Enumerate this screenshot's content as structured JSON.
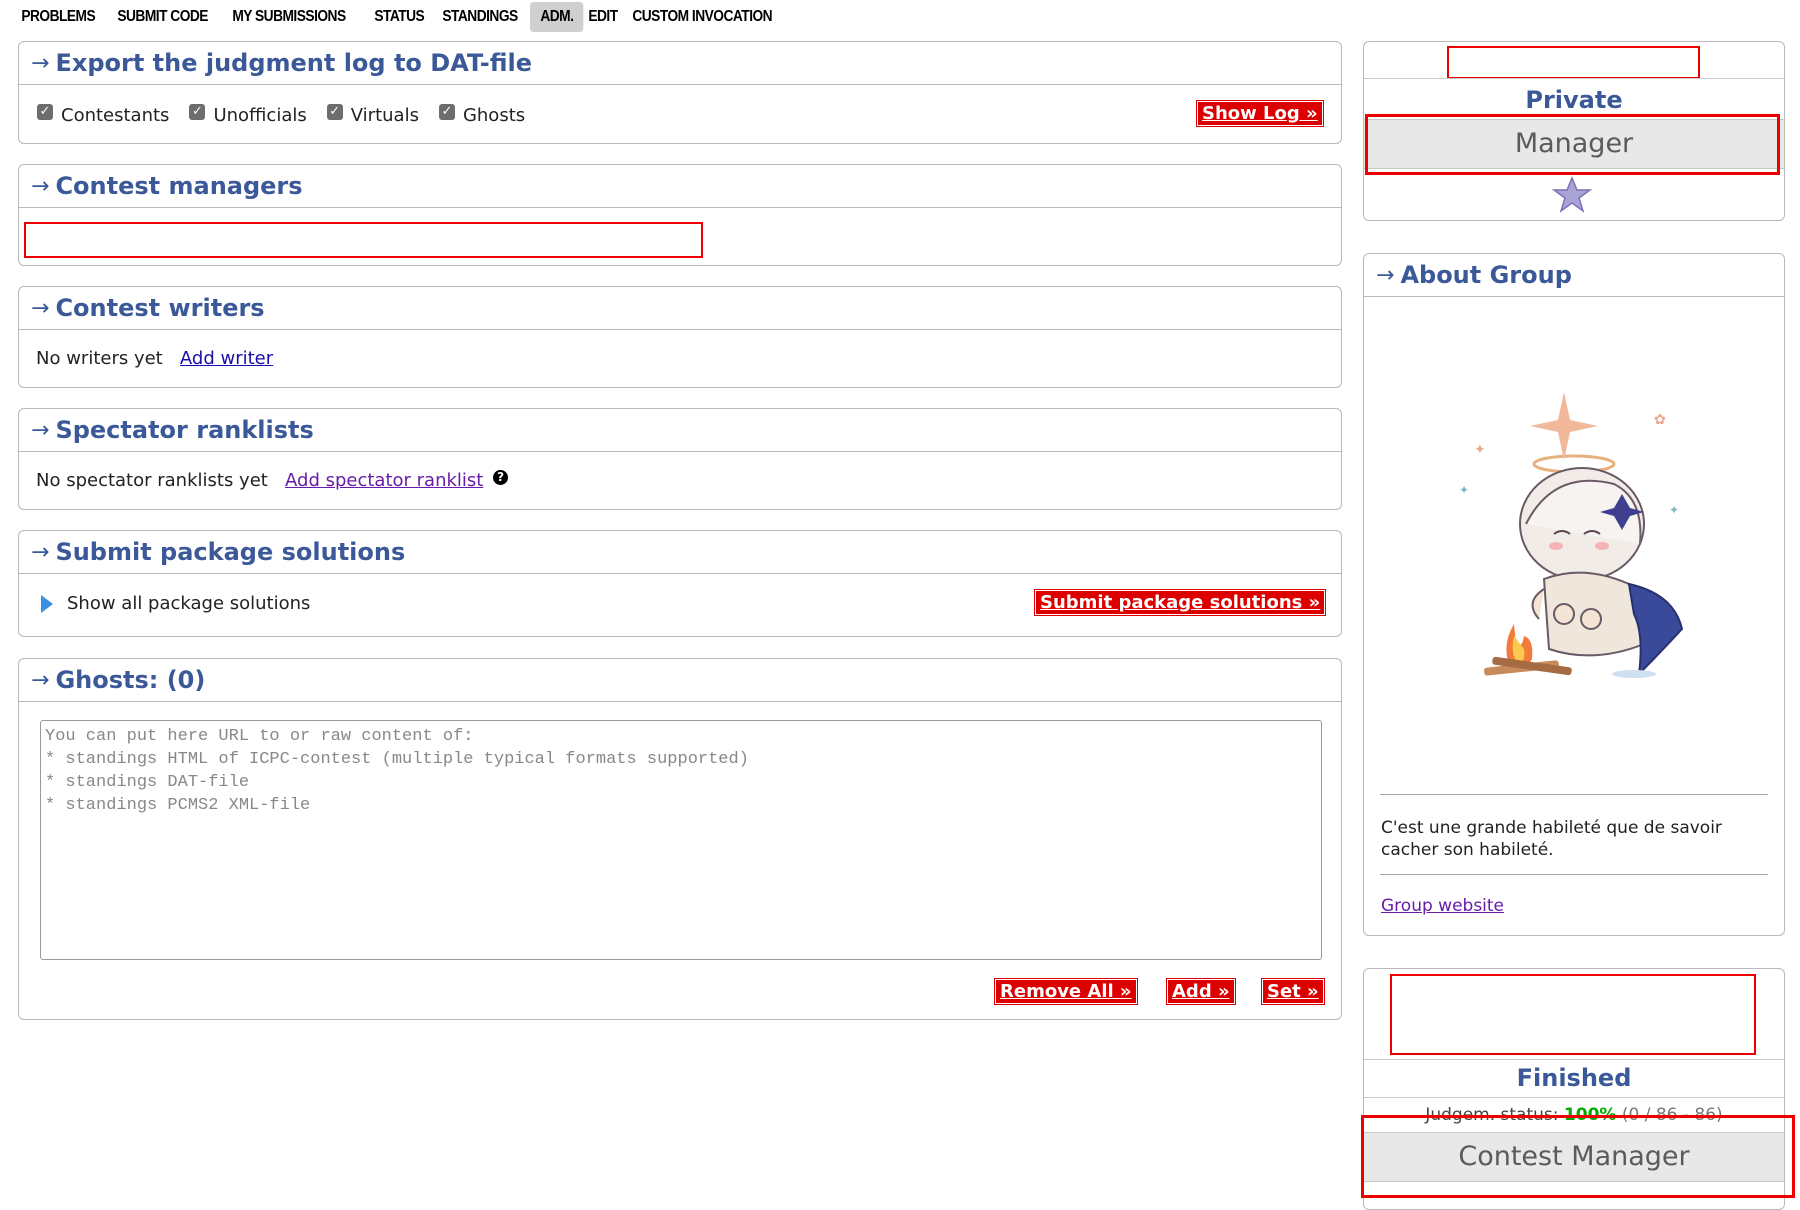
{
  "menu": [
    {
      "label": "PROBLEMS",
      "active": false
    },
    {
      "label": "SUBMIT CODE",
      "active": false
    },
    {
      "label": "MY SUBMISSIONS",
      "active": false
    },
    {
      "label": "STATUS",
      "active": false
    },
    {
      "label": "STANDINGS",
      "active": false
    },
    {
      "label": "ADM.",
      "active": true
    },
    {
      "label": "EDIT",
      "active": false
    },
    {
      "label": "CUSTOM INVOCATION",
      "active": false
    }
  ],
  "export": {
    "arrow": "→",
    "title": "Export the judgment log to DAT-file",
    "checkboxes": [
      {
        "label": "Contestants",
        "checked": true
      },
      {
        "label": "Unofficials",
        "checked": true
      },
      {
        "label": "Virtuals",
        "checked": true
      },
      {
        "label": "Ghosts",
        "checked": true
      }
    ],
    "show_log": "Show Log »"
  },
  "managers": {
    "arrow": "→",
    "title": "Contest managers"
  },
  "writers": {
    "arrow": "→",
    "title": "Contest writers",
    "empty": "No writers yet",
    "add": "Add writer"
  },
  "spectator": {
    "arrow": "→",
    "title": "Spectator ranklists",
    "empty": "No spectator ranklists yet",
    "add": "Add spectator ranklist",
    "help": "?"
  },
  "package": {
    "arrow": "→",
    "title": "Submit package solutions",
    "show_all": "Show all package solutions",
    "submit": "Submit package solutions »"
  },
  "ghosts": {
    "arrow": "→",
    "title": "Ghosts: (0)",
    "placeholder": "You can put here URL to or raw content of:\n* standings HTML of ICPC-contest (multiple typical formats supported)\n* standings DAT-file\n* standings PCMS2 XML-file",
    "remove_all": "Remove All »",
    "add": "Add »",
    "set": "Set »"
  },
  "sidebar": {
    "group_status": "Private",
    "role": "Manager",
    "about": {
      "arrow": "→",
      "title": "About Group",
      "quote": "C'est une grande habileté que de savoir cacher son habileté.",
      "website": "Group website"
    },
    "contest": {
      "phase": "Finished",
      "judgement_label": "Judgem. status:",
      "judgement_percent": "100%",
      "judgement_counts": "(0 / 86 - 86)",
      "role": "Contest Manager"
    }
  },
  "colors": {
    "accent": "#3b5998",
    "button_red": "#dd0000",
    "highlight": "#e00000",
    "success": "#0a0"
  }
}
